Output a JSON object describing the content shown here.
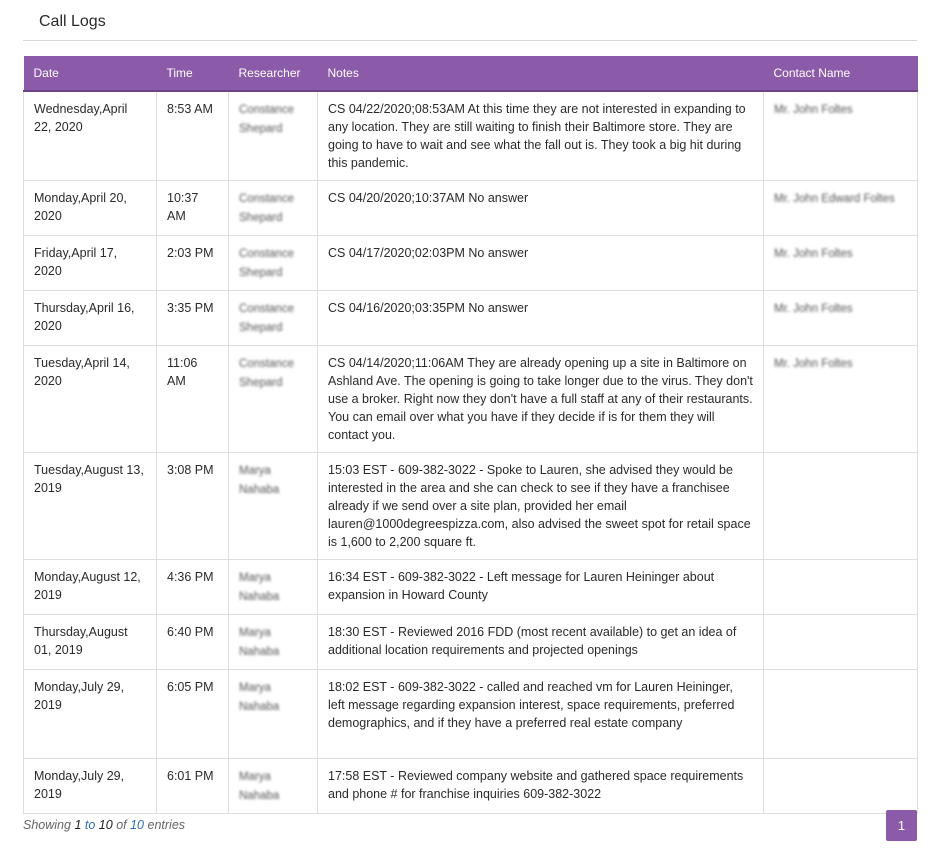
{
  "page": {
    "title": "Call Logs"
  },
  "table": {
    "headers": [
      "Date",
      "Time",
      "Researcher",
      "Notes",
      "Contact Name"
    ],
    "rows": [
      {
        "date": "Wednesday,April 22, 2020",
        "time": "8:53 AM",
        "researcher": "Constance Shepard",
        "notes": "CS 04/22/2020;08:53AM At this time they are not interested in expanding to any location. They are still waiting to finish their Baltimore store. They are going to have to wait and see what the fall out is. They took a big hit during this pandemic.",
        "contact": "Mr. John Foltes"
      },
      {
        "date": "Monday,April 20, 2020",
        "time": "10:37 AM",
        "researcher": "Constance Shepard",
        "notes": "CS 04/20/2020;10:37AM No answer",
        "contact": "Mr. John Edward Foltes"
      },
      {
        "date": "Friday,April 17, 2020",
        "time": "2:03 PM",
        "researcher": "Constance Shepard",
        "notes": "CS 04/17/2020;02:03PM No answer",
        "contact": "Mr. John Foltes"
      },
      {
        "date": "Thursday,April 16, 2020",
        "time": "3:35 PM",
        "researcher": "Constance Shepard",
        "notes": "CS 04/16/2020;03:35PM No answer",
        "contact": "Mr. John Foltes"
      },
      {
        "date": "Tuesday,April 14, 2020",
        "time": "11:06 AM",
        "researcher": "Constance Shepard",
        "notes": "CS 04/14/2020;11:06AM They are already opening up a site in Baltimore on Ashland Ave. The opening is going to take longer due to the virus. They don't use a broker. Right now they don't have a full staff at any of their restaurants. You can email over what you have if they decide if is for them they will contact you.",
        "contact": "Mr. John Foltes"
      },
      {
        "date": "Tuesday,August 13, 2019",
        "time": "3:08 PM",
        "researcher": "Marya Nahaba",
        "notes": "15:03 EST - 609-382-3022 - Spoke to Lauren, she advised they would be interested in the area and she can check to see if they have a franchisee already if we send over a site plan, provided her email lauren@1000degreespizza.com, also advised the sweet spot for retail space is 1,600 to 2,200 square ft.",
        "contact": ""
      },
      {
        "date": "Monday,August 12, 2019",
        "time": "4:36 PM",
        "researcher": "Marya Nahaba",
        "notes": "16:34 EST - 609-382-3022 - Left message for Lauren Heininger about expansion in Howard County",
        "contact": ""
      },
      {
        "date": "Thursday,August 01, 2019",
        "time": "6:40 PM",
        "researcher": "Marya Nahaba",
        "notes": "18:30 EST - Reviewed 2016 FDD (most recent available) to get an idea of additional location requirements and projected openings",
        "contact": ""
      },
      {
        "date": "Monday,July 29, 2019",
        "time": "6:05 PM",
        "researcher": "Marya Nahaba",
        "notes": "18:02 EST - 609-382-3022 - called and reached vm for Lauren Heininger, left message regarding expansion interest, space requirements, preferred demographics, and if they have a preferred real estate company",
        "contact": ""
      },
      {
        "date": "Monday,July 29, 2019",
        "time": "6:01 PM",
        "researcher": "Marya Nahaba",
        "notes": "17:58 EST - Reviewed company website and gathered space requirements and phone # for franchise inquiries 609-382-3022",
        "contact": ""
      }
    ]
  },
  "footer": {
    "showing": "Showing",
    "from": "1",
    "to_word": "to",
    "to": "10",
    "of_word": "of",
    "total": "10",
    "entries_word": "entries"
  },
  "pagination": {
    "current_page": "1"
  },
  "colors": {
    "accent": "#8b5aa8",
    "link": "#2f70b8"
  }
}
